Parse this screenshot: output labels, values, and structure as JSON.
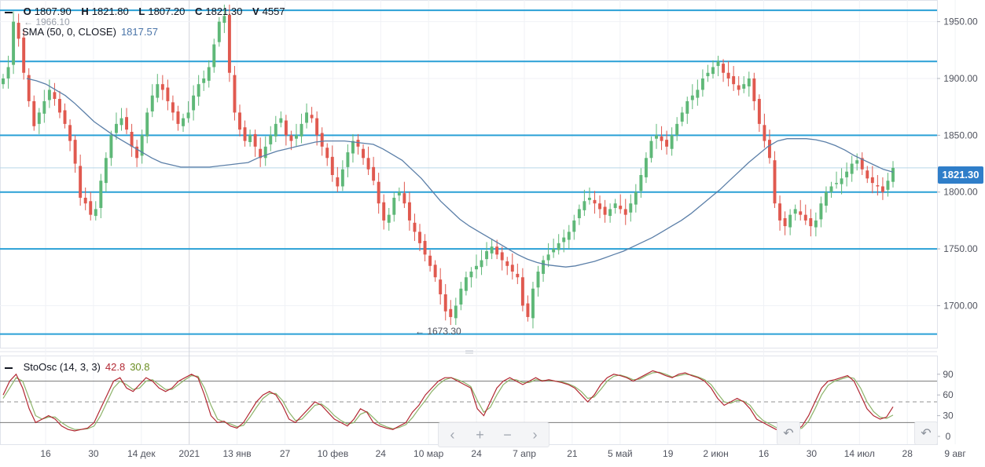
{
  "ohlc": {
    "o_label": "O",
    "o": "1807.90",
    "h_label": "H",
    "h": "1821.80",
    "l_label": "L",
    "l": "1807.20",
    "c_label": "C",
    "c": "1821.30",
    "v_label": "V",
    "v": "4557"
  },
  "sma": {
    "label": "SMA (50, 0, CLOSE)",
    "value": "1817.57"
  },
  "stoch": {
    "label": "StoOsc (14, 3, 3)",
    "k": "42.8",
    "d": "30.8"
  },
  "last_price": "1821.30",
  "high_marker": "1966.10",
  "low_marker": "1673.30",
  "nav": {
    "left": "‹",
    "plus": "+",
    "minus": "−",
    "right": "›"
  },
  "reset_icon": "↶",
  "colors": {
    "up": "#5fb878",
    "down": "#e0594f",
    "sma": "#5b7fa8",
    "hline": "#2aa0d6",
    "k": "#b22833",
    "d": "#8cb369",
    "accent": "#2f7ec9"
  },
  "chart_data": [
    {
      "type": "candlestick",
      "y_ticks": [
        1700,
        1750,
        1800,
        1850,
        1900,
        1950
      ],
      "y_tick_labels": [
        "1700.00",
        "1750.00",
        "1800.00",
        "1850.00",
        "1900.00",
        "1950.00"
      ],
      "ylim": [
        1663,
        1967
      ],
      "x_tick_labels": [
        "16",
        "30",
        "14 дек",
        "2021",
        "13 янв",
        "27",
        "10 фев",
        "24",
        "10 мар",
        "24",
        "7 апр",
        "21",
        "5 май",
        "19",
        "2 июн",
        "16",
        "30",
        "14 июл",
        "28",
        "9 авг"
      ],
      "horizontal_levels": [
        1960,
        1915,
        1850,
        1800,
        1750,
        1675
      ],
      "close": [
        1900,
        1910,
        1950,
        1935,
        1905,
        1880,
        1858,
        1870,
        1880,
        1890,
        1882,
        1870,
        1860,
        1845,
        1825,
        1795,
        1790,
        1780,
        1785,
        1810,
        1830,
        1850,
        1860,
        1865,
        1855,
        1840,
        1830,
        1850,
        1870,
        1885,
        1895,
        1890,
        1880,
        1870,
        1860,
        1865,
        1870,
        1885,
        1895,
        1900,
        1910,
        1930,
        1950,
        1955,
        1905,
        1870,
        1855,
        1845,
        1850,
        1840,
        1830,
        1840,
        1850,
        1860,
        1865,
        1850,
        1845,
        1850,
        1860,
        1870,
        1865,
        1850,
        1840,
        1830,
        1815,
        1805,
        1820,
        1835,
        1845,
        1840,
        1830,
        1820,
        1810,
        1790,
        1775,
        1780,
        1795,
        1800,
        1790,
        1775,
        1765,
        1755,
        1745,
        1735,
        1725,
        1710,
        1695,
        1690,
        1700,
        1715,
        1725,
        1730,
        1735,
        1740,
        1748,
        1752,
        1745,
        1740,
        1735,
        1730,
        1725,
        1700,
        1690,
        1715,
        1730,
        1740,
        1745,
        1750,
        1755,
        1760,
        1765,
        1775,
        1785,
        1792,
        1795,
        1790,
        1785,
        1780,
        1785,
        1790,
        1785,
        1780,
        1790,
        1800,
        1815,
        1830,
        1845,
        1850,
        1845,
        1840,
        1850,
        1860,
        1870,
        1880,
        1885,
        1890,
        1900,
        1905,
        1910,
        1915,
        1905,
        1900,
        1895,
        1890,
        1895,
        1900,
        1880,
        1860,
        1845,
        1830,
        1790,
        1775,
        1770,
        1780,
        1785,
        1780,
        1775,
        1770,
        1775,
        1790,
        1800,
        1805,
        1808,
        1812,
        1818,
        1825,
        1828,
        1820,
        1812,
        1808,
        1805,
        1800,
        1810,
        1821.3
      ],
      "sma": [
        1900,
        1898,
        1895,
        1890,
        1885,
        1878,
        1870,
        1862,
        1856,
        1850,
        1845,
        1840,
        1835,
        1830,
        1826,
        1824,
        1822,
        1822,
        1822,
        1822,
        1823,
        1824,
        1825,
        1826,
        1830,
        1833,
        1836,
        1838,
        1840,
        1842,
        1844,
        1845,
        1845,
        1845,
        1844,
        1843,
        1842,
        1838,
        1833,
        1828,
        1820,
        1812,
        1802,
        1792,
        1784,
        1776,
        1770,
        1765,
        1760,
        1755,
        1750,
        1745,
        1741,
        1738,
        1736,
        1735,
        1734,
        1735,
        1737,
        1739,
        1742,
        1745,
        1748,
        1752,
        1756,
        1760,
        1765,
        1770,
        1775,
        1781,
        1788,
        1795,
        1802,
        1810,
        1818,
        1826,
        1833,
        1840,
        1845,
        1847,
        1847,
        1847,
        1846,
        1844,
        1841,
        1837,
        1832,
        1828,
        1824,
        1820,
        1817.57
      ],
      "stoch_yticks": [
        0,
        30,
        60,
        90
      ],
      "stoch_levels": [
        80,
        50,
        20
      ],
      "k": [
        60,
        80,
        90,
        70,
        40,
        20,
        25,
        30,
        25,
        15,
        10,
        8,
        10,
        12,
        20,
        40,
        60,
        80,
        85,
        70,
        65,
        75,
        85,
        80,
        70,
        65,
        70,
        80,
        85,
        90,
        85,
        60,
        30,
        20,
        22,
        15,
        12,
        20,
        35,
        50,
        60,
        65,
        60,
        45,
        25,
        20,
        30,
        40,
        50,
        45,
        35,
        25,
        20,
        15,
        25,
        40,
        35,
        20,
        15,
        12,
        10,
        15,
        20,
        35,
        45,
        60,
        70,
        80,
        85,
        85,
        80,
        75,
        70,
        40,
        30,
        50,
        70,
        80,
        85,
        80,
        75,
        80,
        85,
        80,
        82,
        80,
        78,
        75,
        70,
        60,
        50,
        60,
        75,
        85,
        90,
        88,
        85,
        80,
        85,
        90,
        95,
        92,
        88,
        85,
        90,
        92,
        88,
        85,
        80,
        70,
        55,
        45,
        50,
        55,
        50,
        40,
        25,
        20,
        15,
        10,
        12,
        10,
        8,
        15,
        30,
        50,
        70,
        80,
        82,
        85,
        88,
        80,
        60,
        40,
        30,
        25,
        28,
        42.8
      ],
      "d": [
        55,
        70,
        85,
        80,
        55,
        30,
        25,
        28,
        28,
        20,
        14,
        10,
        10,
        11,
        15,
        30,
        50,
        70,
        80,
        75,
        68,
        70,
        80,
        82,
        75,
        68,
        68,
        75,
        82,
        88,
        87,
        70,
        45,
        25,
        21,
        18,
        14,
        16,
        28,
        42,
        55,
        62,
        62,
        52,
        35,
        23,
        25,
        35,
        45,
        47,
        40,
        30,
        23,
        18,
        20,
        32,
        36,
        27,
        18,
        14,
        11,
        13,
        17,
        27,
        40,
        52,
        65,
        75,
        82,
        85,
        82,
        78,
        72,
        52,
        35,
        42,
        60,
        75,
        82,
        82,
        78,
        78,
        82,
        81,
        81,
        80,
        79,
        76,
        72,
        65,
        55,
        57,
        68,
        80,
        87,
        89,
        86,
        82,
        83,
        88,
        92,
        93,
        90,
        86,
        88,
        90,
        89,
        86,
        82,
        75,
        62,
        50,
        48,
        52,
        51,
        45,
        32,
        23,
        18,
        13,
        11,
        10,
        9,
        12,
        22,
        40,
        60,
        74,
        80,
        83,
        86,
        84,
        70,
        50,
        36,
        28,
        26,
        30.8
      ]
    }
  ]
}
